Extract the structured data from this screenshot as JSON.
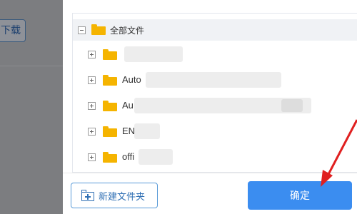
{
  "background": {
    "download_button_label": "下载"
  },
  "tree": {
    "root": {
      "label": "全部文件",
      "icon": "folder-icon",
      "toggle": "collapse-icon"
    },
    "items": [
      {
        "label": ""
      },
      {
        "label": "Auto"
      },
      {
        "label": "Au"
      },
      {
        "label": "EN"
      },
      {
        "label": "offi"
      }
    ]
  },
  "footer": {
    "new_folder_label": "新建文件夹",
    "new_folder_icon": "folder-plus-icon",
    "confirm_label": "确定"
  },
  "colors": {
    "accent": "#3b8df0",
    "folder": "#f5b400",
    "annotation_arrow": "#e02020"
  }
}
